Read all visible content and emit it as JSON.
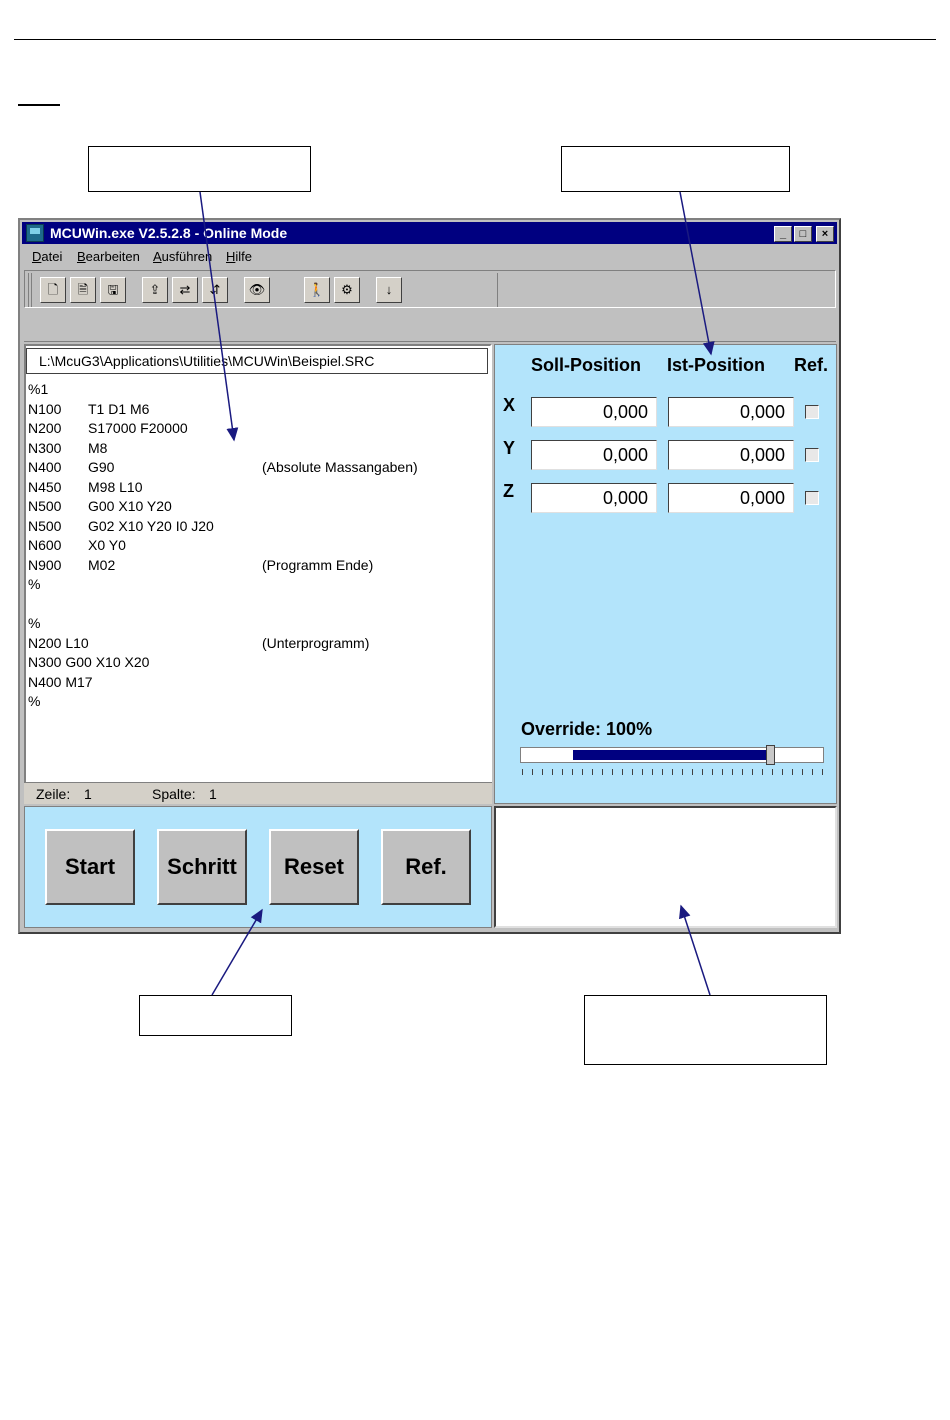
{
  "window": {
    "title": "MCUWin.exe V2.5.2.8 - Online Mode",
    "controls": {
      "minimize": "_",
      "maximize": "□",
      "close": "×"
    }
  },
  "menu": [
    "Datei",
    "Bearbeiten",
    "Ausführen",
    "Hilfe"
  ],
  "toolbar": {
    "icons": [
      "new-file-icon",
      "open-file-icon",
      "save-file-icon",
      "load-icon",
      "transfer-icon",
      "compare-icon",
      "find-icon",
      "person-icon",
      "settings-icon",
      "download-icon"
    ],
    "glyphs": [
      "🗋",
      "🗎",
      "🖫",
      "⇪",
      "⇄",
      "⇵",
      "👁",
      "🚶",
      "⚙",
      "↓"
    ]
  },
  "editor": {
    "path": "L:\\McuG3\\Applications\\Utilities\\MCUWin\\Beispiel.SRC",
    "lines": [
      [
        "%1",
        "",
        ""
      ],
      [
        "N100",
        "T1 D1 M6",
        ""
      ],
      [
        "N200",
        "S17000 F20000",
        ""
      ],
      [
        "N300",
        "M8",
        ""
      ],
      [
        "N400",
        "G90",
        "(Absolute Massangaben)"
      ],
      [
        "N450",
        "M98 L10",
        ""
      ],
      [
        "N500",
        "G00 X10 Y20",
        ""
      ],
      [
        "N500",
        "G02 X10 Y20 I0 J20",
        ""
      ],
      [
        "N600",
        "X0 Y0",
        ""
      ],
      [
        "N900",
        "M02",
        "(Programm Ende)"
      ],
      [
        "%",
        "",
        ""
      ],
      [
        "",
        "",
        ""
      ],
      [
        "%",
        "",
        ""
      ],
      [
        "N200 L10",
        "",
        "(Unterprogramm)"
      ],
      [
        "N300 G00 X10 X20",
        "",
        ""
      ],
      [
        "N400 M17",
        "",
        ""
      ],
      [
        "%",
        "",
        ""
      ]
    ],
    "status": {
      "zeile_label": "Zeile:",
      "zeile_value": "1",
      "spalte_label": "Spalte:",
      "spalte_value": "1"
    }
  },
  "positions": {
    "headers": {
      "soll": "Soll-Position",
      "ist": "Ist-Position",
      "ref": "Ref."
    },
    "axes": [
      {
        "label": "X",
        "soll": "0,000",
        "ist": "0,000"
      },
      {
        "label": "Y",
        "soll": "0,000",
        "ist": "0,000"
      },
      {
        "label": "Z",
        "soll": "0,000",
        "ist": "0,000"
      }
    ],
    "override_label": "Override: 100%",
    "override_value": 1.0
  },
  "buttons": {
    "start": "Start",
    "schritt": "Schritt",
    "reset": "Reset",
    "ref": "Ref."
  },
  "colors": {
    "title_bar": "#000080",
    "panel": "#b3e4fb",
    "face": "#c0c0c0"
  }
}
